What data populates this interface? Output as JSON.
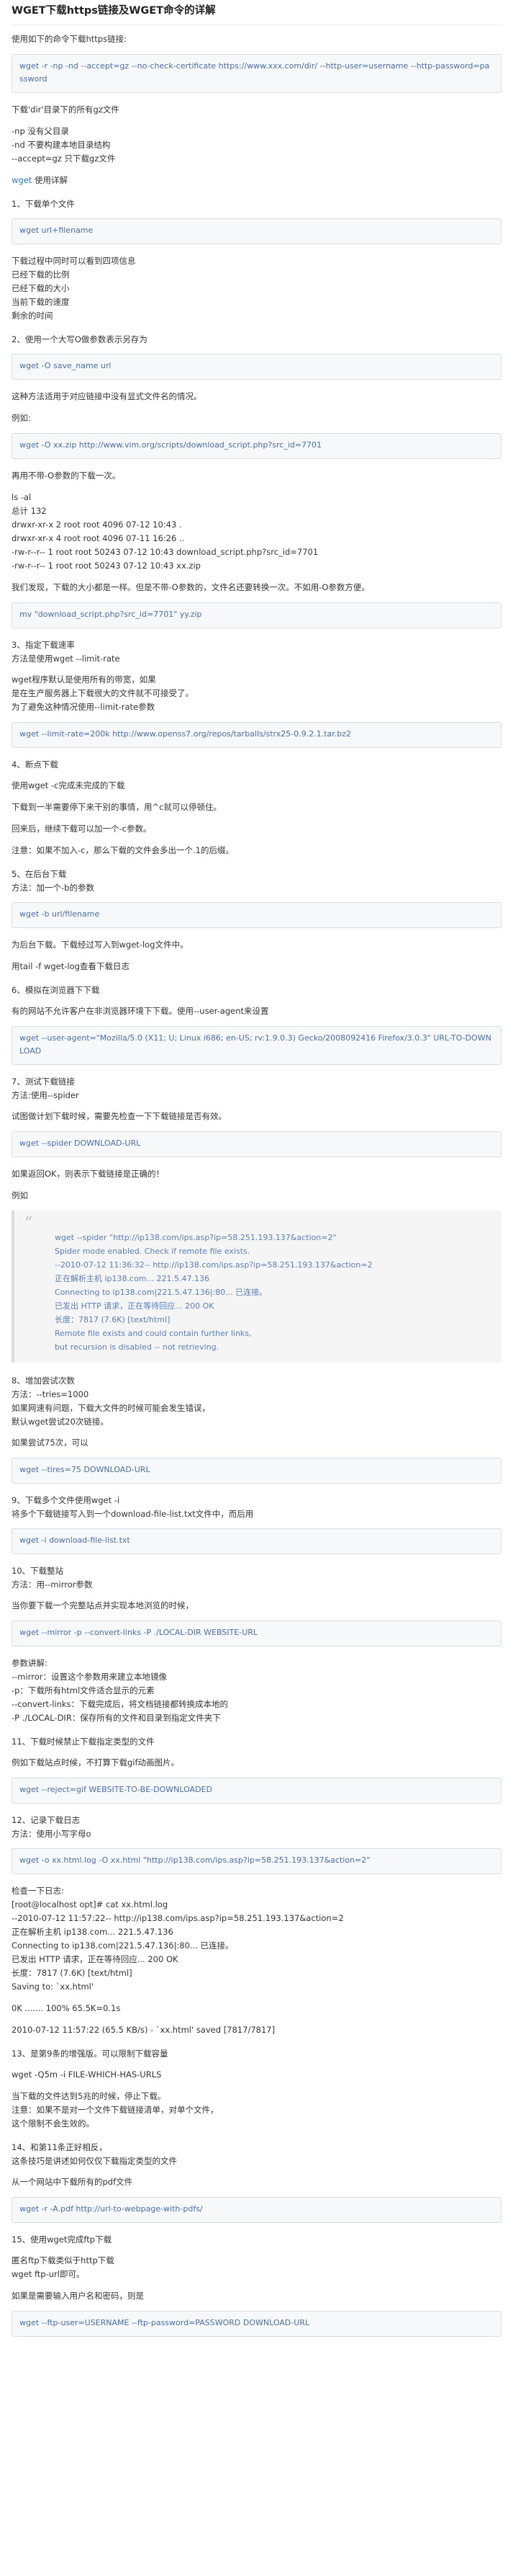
{
  "title": "WGET下载https链接及WGET命令的详解",
  "blocks": [
    {
      "t": "p",
      "text": "使用如下的命令下载https链接:"
    },
    {
      "t": "code",
      "text": "wget -r -np -nd --accept=gz --no-check-certificate https://www.xxx.com/dir/ --http-user=username --http-password=password"
    },
    {
      "t": "p",
      "text": "下载'dir'目录下的所有gz文件"
    },
    {
      "t": "p",
      "text": "-np 没有父目录\n-nd 不要构建本地目录结构\n--accept=gz 只下载gz文件"
    },
    {
      "t": "linkp",
      "link": "wget",
      "text": " 使用详解"
    },
    {
      "t": "h",
      "text": "1、下载单个文件"
    },
    {
      "t": "code",
      "text": "wget url+filename"
    },
    {
      "t": "p",
      "text": "下载过程中同时可以看到四项信息\n已经下载的比例\n已经下载的大小\n当前下载的速度\n剩余的时间"
    },
    {
      "t": "h",
      "text": "2、使用一个大写O做参数表示另存为"
    },
    {
      "t": "code",
      "text": "wget -O save_name url"
    },
    {
      "t": "p",
      "text": "这种方法适用于对应链接中没有显式文件名的情况。"
    },
    {
      "t": "p",
      "text": "例如:"
    },
    {
      "t": "code",
      "text": "wget -O xx.zip http://www.vim.org/scripts/download_script.php?src_id=7701"
    },
    {
      "t": "p",
      "text": "再用不带-O参数的下载一次。"
    },
    {
      "t": "p",
      "text": "ls -al\n总计 132\ndrwxr-xr-x 2 root root 4096 07-12 10:43 .\ndrwxr-xr-x 4 root root 4096 07-11 16:26 ..\n-rw-r--r-- 1 root root 50243 07-12 10:43 download_script.php?src_id=7701\n-rw-r--r-- 1 root root 50243 07-12 10:43 xx.zip"
    },
    {
      "t": "p",
      "text": "我们发现，下载的大小都是一样。但是不带-O参数的，文件名还要转换一次。不如用-O参数方便。"
    },
    {
      "t": "code",
      "text": "mv \"download_script.php?src_id=7701\" yy.zip"
    },
    {
      "t": "h",
      "text": "3、指定下载速率\n方法是使用wget --limit-rate"
    },
    {
      "t": "p",
      "text": "wget程序默认是使用所有的带宽，如果\n是在生产服务器上下载很大的文件就不可接受了。\n为了避免这种情况使用--limit-rate参数"
    },
    {
      "t": "code",
      "text": "wget --limit-rate=200k http://www.openss7.org/repos/tarballs/strx25-0.9.2.1.tar.bz2"
    },
    {
      "t": "h",
      "text": "4、断点下载"
    },
    {
      "t": "p",
      "text": "使用wget -c完成未完成的下载"
    },
    {
      "t": "p",
      "text": "下载到一半需要停下来干别的事情，用^c就可以停顿住。"
    },
    {
      "t": "p",
      "text": "回来后，继续下载可以加一个-c参数。"
    },
    {
      "t": "p",
      "text": "注意：如果不加入-c，那么下载的文件会多出一个.1的后缀。"
    },
    {
      "t": "h",
      "text": "5、在后台下载\n方法：加一个-b的参数"
    },
    {
      "t": "code",
      "text": "wget -b url/filename"
    },
    {
      "t": "p",
      "text": "为后台下载。下载经过写入到wget-log文件中。"
    },
    {
      "t": "p",
      "text": "用tail -f wget-log查看下载日志"
    },
    {
      "t": "h",
      "text": "6、模拟在浏览器下下载"
    },
    {
      "t": "p",
      "text": "有的网站不允许客户在非浏览器环境下下载。使用--user-agent来设置"
    },
    {
      "t": "code",
      "text": "wget --user-agent=\"Mozilla/5.0 (X11; U; Linux i686; en-US; rv:1.9.0.3) Gecko/2008092416 Firefox/3.0.3\" URL-TO-DOWNLOAD"
    },
    {
      "t": "h",
      "text": "7、测试下载链接\n方法:使用--spider"
    },
    {
      "t": "p",
      "text": "试图做计划下载时候，需要先检查一下下载链接是否有效。"
    },
    {
      "t": "code",
      "text": "wget --spider DOWNLOAD-URL"
    },
    {
      "t": "p",
      "text": "如果返回OK，则表示下载链接是正确的！"
    },
    {
      "t": "p",
      "text": "例如"
    },
    {
      "t": "quote",
      "lines": [
        "wget --spider \"http://ip138.com/ips.asp?ip=58.251.193.137&action=2\"",
        "Spider mode enabled. Check if remote file exists.",
        "--2010-07-12 11:36:32-- http://ip138.com/ips.asp?ip=58.251.193.137&action=2",
        "正在解析主机 ip138.com... 221.5.47.136",
        "Connecting to ip138.com|221.5.47.136|:80... 已连接。",
        "已发出 HTTP 请求，正在等待回应... 200 OK",
        "长度：7817 (7.6K) [text/html]",
        "Remote file exists and could contain further links,",
        "but recursion is disabled -- not retrieving."
      ]
    },
    {
      "t": "h",
      "text": "8、增加尝试次数\n方法：--tries=1000\n如果网速有问题，下载大文件的时候可能会发生错误，\n默认wget尝试20次链接。"
    },
    {
      "t": "p",
      "text": "如果尝试75次，可以"
    },
    {
      "t": "code",
      "text": "wget --tires=75 DOWNLOAD-URL"
    },
    {
      "t": "h",
      "text": "9、下载多个文件使用wget -i\n将多个下载链接写入到一个download-file-list.txt文件中，而后用"
    },
    {
      "t": "code",
      "text": "wget -i download-file-list.txt"
    },
    {
      "t": "h",
      "text": "10、下载整站\n方法：用--mirror参数"
    },
    {
      "t": "p",
      "text": "当你要下载一个完整站点并实现本地浏览的时候，"
    },
    {
      "t": "code",
      "text": "wget --mirror -p --convert-links -P ./LOCAL-DIR WEBSITE-URL"
    },
    {
      "t": "p",
      "text": "参数讲解:\n--mirror：设置这个参数用来建立本地镜像\n-p：下载所有html文件适合显示的元素\n--convert-links：下载完成后，将文档链接都转换成本地的\n-P ./LOCAL-DIR：保存所有的文件和目录到指定文件夹下"
    },
    {
      "t": "h",
      "text": "11、下载时候禁止下载指定类型的文件"
    },
    {
      "t": "p",
      "text": "例如下载站点时候，不打算下载gif动画图片。"
    },
    {
      "t": "code",
      "text": "wget --reject=gif WEBSITE-TO-BE-DOWNLOADED"
    },
    {
      "t": "h",
      "text": "12、记录下载日志\n方法：使用小写字母o"
    },
    {
      "t": "code",
      "text": "wget -o xx.html.log -O xx.html \"http://ip138.com/ips.asp?ip=58.251.193.137&action=2\""
    },
    {
      "t": "p",
      "text": "检查一下日志:\n[root@localhost opt]# cat xx.html.log\n--2010-07-12 11:57:22-- http://ip138.com/ips.asp?ip=58.251.193.137&action=2\n正在解析主机 ip138.com... 221.5.47.136\nConnecting to ip138.com|221.5.47.136|:80... 已连接。\n已发出 HTTP 请求，正在等待回应... 200 OK\n长度：7817 (7.6K) [text/html]\nSaving to: `xx.html'"
    },
    {
      "t": "p",
      "text": "0K ....... 100% 65.5K=0.1s"
    },
    {
      "t": "p",
      "text": "2010-07-12 11:57:22 (65.5 KB/s) - `xx.html' saved [7817/7817]"
    },
    {
      "t": "h",
      "text": "13、是第9条的增强版。可以限制下载容量"
    },
    {
      "t": "p",
      "text": "wget -Q5m -i FILE-WHICH-HAS-URLS"
    },
    {
      "t": "p",
      "text": "当下载的文件达到5兆的时候，停止下载。\n注意：如果不是对一个文件下载链接清单，对单个文件，\n这个限制不会生效的。"
    },
    {
      "t": "h",
      "text": "14、和第11条正好相反，\n这条技巧是讲述如何仅仅下载指定类型的文件"
    },
    {
      "t": "p",
      "text": "从一个网站中下载所有的pdf文件"
    },
    {
      "t": "code",
      "text": "wget -r -A.pdf http://url-to-webpage-with-pdfs/"
    },
    {
      "t": "h",
      "text": "15、使用wget完成ftp下载"
    },
    {
      "t": "p",
      "text": "匿名ftp下载类似于http下载\nwget ftp-url即可。"
    },
    {
      "t": "p",
      "text": "如果是需要输入用户名和密码，则是"
    },
    {
      "t": "code",
      "text": "wget --ftp-user=USERNAME --ftp-password=PASSWORD DOWNLOAD-URL"
    }
  ]
}
